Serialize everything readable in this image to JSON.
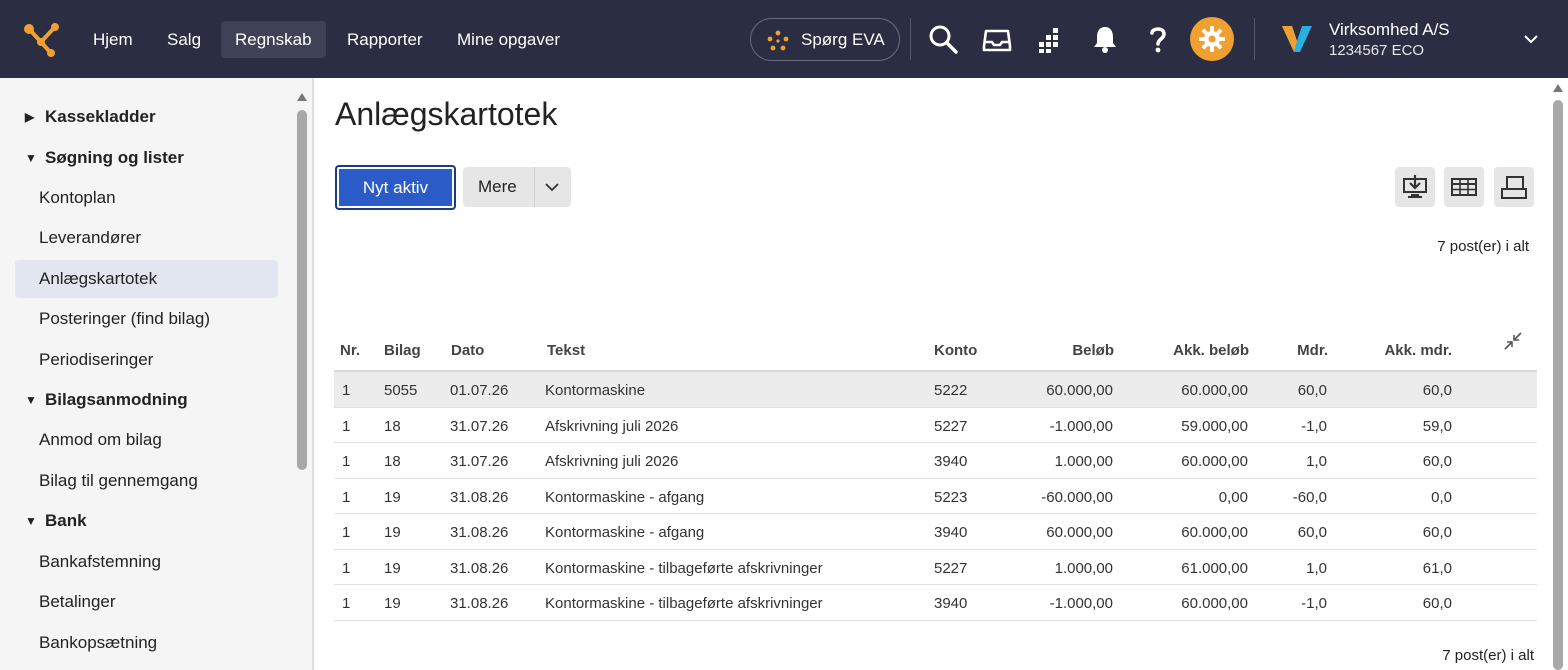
{
  "nav": {
    "items": [
      {
        "label": "Hjem"
      },
      {
        "label": "Salg"
      },
      {
        "label": "Regnskab"
      },
      {
        "label": "Rapporter"
      },
      {
        "label": "Mine opgaver"
      }
    ],
    "active": "Regnskab",
    "eva_label": "Spørg EVA",
    "icons": [
      "search-icon",
      "inbox-icon",
      "apps-grid-icon",
      "bell-icon",
      "help-icon",
      "settings-gear-icon"
    ],
    "company": {
      "name": "Virksomhed A/S",
      "sub": "1234567 ECO"
    },
    "colors": {
      "bar": "#2b2d42",
      "gear": "#f0a030",
      "active_tab": "#3f4156"
    }
  },
  "sidebar": {
    "items": [
      {
        "label": "Kassekladder",
        "type": "section",
        "expanded": false
      },
      {
        "label": "Søgning og lister",
        "type": "section",
        "expanded": true
      },
      {
        "label": "Kontoplan",
        "type": "child"
      },
      {
        "label": "Leverandører",
        "type": "child"
      },
      {
        "label": "Anlægskartotek",
        "type": "child",
        "active": true
      },
      {
        "label": "Posteringer (find bilag)",
        "type": "child"
      },
      {
        "label": "Periodiseringer",
        "type": "child"
      },
      {
        "label": "Bilagsanmodning",
        "type": "section",
        "expanded": true
      },
      {
        "label": "Anmod om bilag",
        "type": "child"
      },
      {
        "label": "Bilag til gennemgang",
        "type": "child"
      },
      {
        "label": "Bank",
        "type": "section",
        "expanded": true
      },
      {
        "label": "Bankafstemning",
        "type": "child"
      },
      {
        "label": "Betalinger",
        "type": "child"
      },
      {
        "label": "Bankopsætning",
        "type": "child"
      }
    ]
  },
  "main": {
    "title": "Anlægskartotek",
    "primary_button": "Nyt aktiv",
    "more_button": "Mere",
    "tool_icons": [
      "export-download-icon",
      "table-columns-icon",
      "print-icon"
    ],
    "count_top": "7 post(er) i alt",
    "count_bottom": "7 post(er) i alt",
    "accent": "#2a5bc6"
  },
  "table": {
    "headers": {
      "nr": "Nr.",
      "bilag": "Bilag",
      "dato": "Dato",
      "tekst": "Tekst",
      "konto": "Konto",
      "belob": "Beløb",
      "akk_belob": "Akk. beløb",
      "mdr": "Mdr.",
      "akk_mdr": "Akk. mdr."
    },
    "rows": [
      {
        "nr": "1",
        "bilag": "5055",
        "dato": "01.07.26",
        "tekst": "Kontormaskine",
        "konto": "5222",
        "belob": "60.000,00",
        "akk_belob": "60.000,00",
        "mdr": "60,0",
        "akk_mdr": "60,0"
      },
      {
        "nr": "1",
        "bilag": "18",
        "dato": "31.07.26",
        "tekst": "Afskrivning juli 2026",
        "konto": "5227",
        "belob": "-1.000,00",
        "akk_belob": "59.000,00",
        "mdr": "-1,0",
        "akk_mdr": "59,0"
      },
      {
        "nr": "1",
        "bilag": "18",
        "dato": "31.07.26",
        "tekst": "Afskrivning juli 2026",
        "konto": "3940",
        "belob": "1.000,00",
        "akk_belob": "60.000,00",
        "mdr": "1,0",
        "akk_mdr": "60,0"
      },
      {
        "nr": "1",
        "bilag": "19",
        "dato": "31.08.26",
        "tekst": "Kontormaskine - afgang",
        "konto": "5223",
        "belob": "-60.000,00",
        "akk_belob": "0,00",
        "mdr": "-60,0",
        "akk_mdr": "0,0"
      },
      {
        "nr": "1",
        "bilag": "19",
        "dato": "31.08.26",
        "tekst": "Kontormaskine - afgang",
        "konto": "3940",
        "belob": "60.000,00",
        "akk_belob": "60.000,00",
        "mdr": "60,0",
        "akk_mdr": "60,0"
      },
      {
        "nr": "1",
        "bilag": "19",
        "dato": "31.08.26",
        "tekst": "Kontormaskine - tilbageførte afskrivninger",
        "konto": "5227",
        "belob": "1.000,00",
        "akk_belob": "61.000,00",
        "mdr": "1,0",
        "akk_mdr": "61,0"
      },
      {
        "nr": "1",
        "bilag": "19",
        "dato": "31.08.26",
        "tekst": "Kontormaskine - tilbageførte afskrivninger",
        "konto": "3940",
        "belob": "-1.000,00",
        "akk_belob": "60.000,00",
        "mdr": "-1,0",
        "akk_mdr": "60,0"
      }
    ]
  }
}
